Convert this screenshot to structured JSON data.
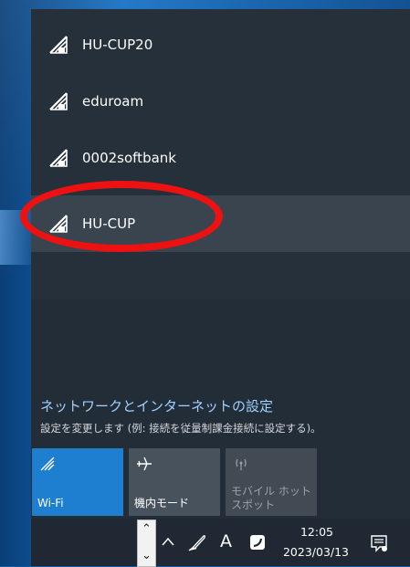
{
  "networks": [
    {
      "name": "HU-CUP20",
      "icon": "wifi-secured-icon"
    },
    {
      "name": "eduroam",
      "icon": "wifi-secured-icon"
    },
    {
      "name": "0002softbank",
      "icon": "wifi-secured-icon"
    },
    {
      "name": "HU-CUP",
      "icon": "wifi-secured-icon"
    }
  ],
  "settings": {
    "link": "ネットワークとインターネットの設定",
    "description": "設定を変更します (例: 接続を従量制課金接続に設定する)。"
  },
  "quick_actions": [
    {
      "label": "Wi-Fi",
      "icon": "wifi-icon",
      "state": "on"
    },
    {
      "label": "機内モード",
      "icon": "airplane-icon",
      "state": "off"
    },
    {
      "label": "モバイル ホットスポット",
      "icon": "hotspot-icon",
      "state": "disabled"
    }
  ],
  "taskbar": {
    "ime_label": "A",
    "time": "12:05",
    "date": "2023/03/13"
  },
  "colors": {
    "flyout_bg": "#26303a",
    "selected_bg": "#3a444e",
    "accent": "#1e7fd1",
    "link": "#9fd0ff",
    "annotation": "#ee1111"
  }
}
